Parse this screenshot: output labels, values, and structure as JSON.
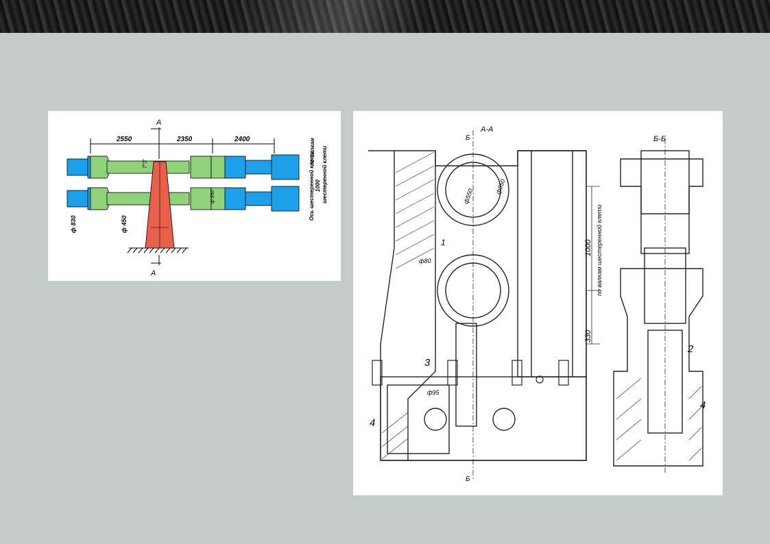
{
  "left_drawing": {
    "section_label_top": "А",
    "section_label_bottom": "А",
    "dim_1": "2550",
    "dim_2": "2350",
    "dim_3": "2400",
    "angle": "7°3'",
    "dia_830": "ф 830",
    "dia_450": "ф 450",
    "dia_950": "ф 950",
    "axis_label_1": "Ось шестеренной клети",
    "axis_label_2": "1000",
    "axis_label_3": "по валкам",
    "axis_label_4": "шестеренной клети",
    "colors": {
      "blue": "#1ea0e8",
      "green": "#8fd27a",
      "red": "#e8604a"
    }
  },
  "right_drawing": {
    "section_aa": "А-А",
    "section_bb": "Б-Б",
    "label_b_top": "Б",
    "label_b_bottom": "Б",
    "dia_550": "ф550",
    "dia_950": "ф950",
    "dim_1000": "1000",
    "dim_1000_note": "по валкам шестеренной клети",
    "dim_330": "330",
    "dia_80": "ф80",
    "dia_95": "ф95",
    "callout_3": "3",
    "callout_4_left": "4",
    "callout_2": "2",
    "callout_4_right": "4",
    "callout_1": "1"
  }
}
